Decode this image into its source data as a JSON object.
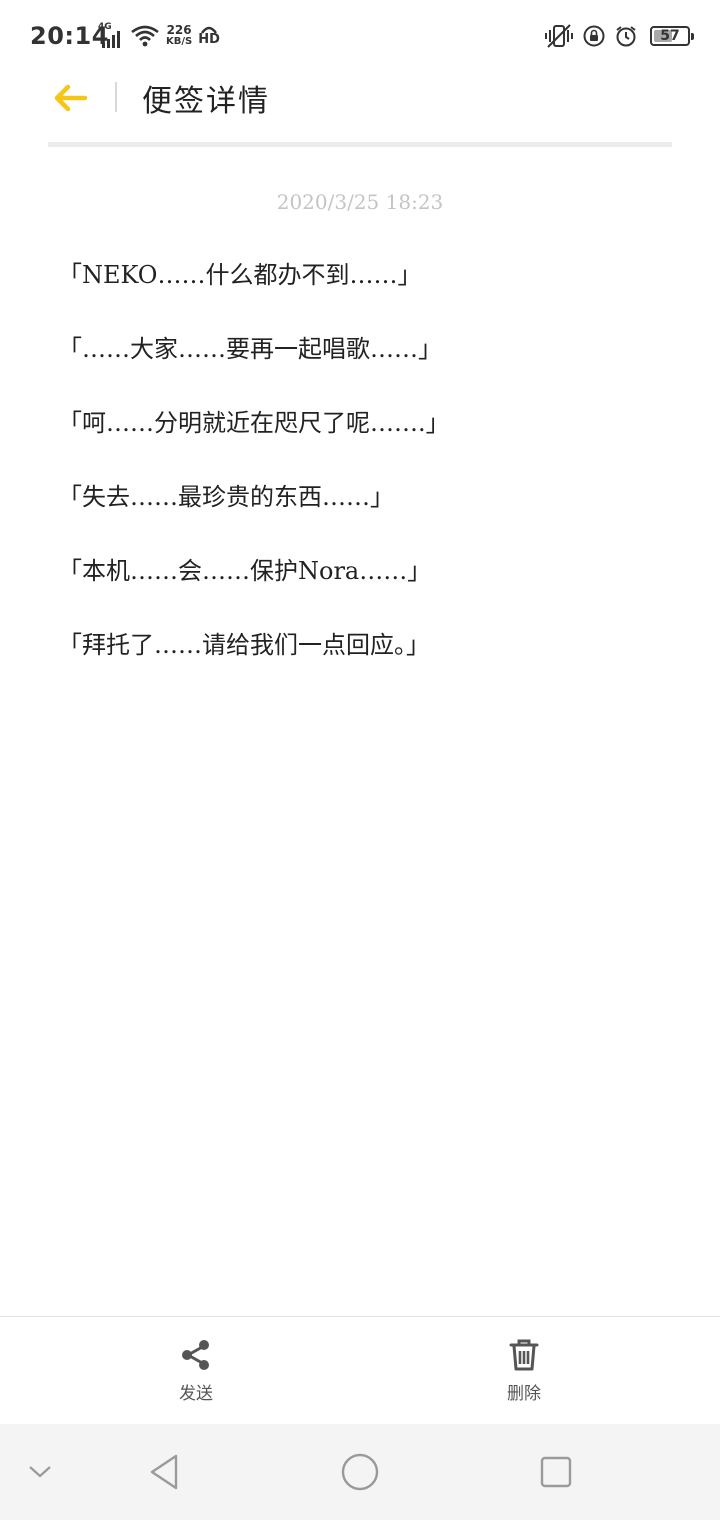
{
  "status_bar": {
    "time": "20:14",
    "network_type": "4G",
    "net_speed_value": "226",
    "net_speed_unit": "KB/S",
    "hd_label": "HD",
    "battery_level": "57"
  },
  "header": {
    "title": "便签详情"
  },
  "note": {
    "timestamp": "2020/3/25 18:23",
    "lines": [
      "「NEKO……什么都办不到……」",
      "「……大家……要再一起唱歌……」",
      "「呵……分明就近在咫尺了呢…….」",
      "「失去……最珍贵的东西……」",
      "「本机……会……保护Nora……」",
      "「拜托了……请给我们一点回应。」"
    ]
  },
  "actions": {
    "send_label": "发送",
    "delete_label": "删除"
  },
  "colors": {
    "accent": "#f5c518",
    "icon_dark": "#555555",
    "timestamp": "#c4c4c4"
  }
}
